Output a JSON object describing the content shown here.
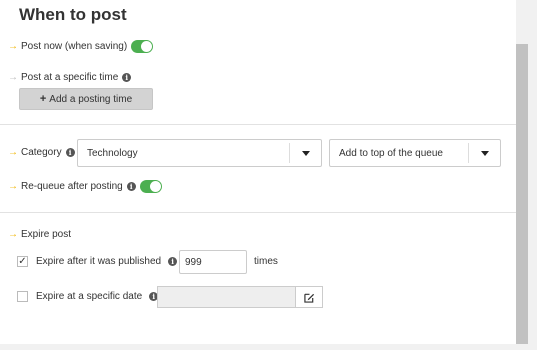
{
  "heading": "When to post",
  "post_now": {
    "label": "Post now (when saving)",
    "enabled": true
  },
  "post_specific": {
    "label": "Post at a specific time",
    "button_label": "Add a posting time"
  },
  "category": {
    "label": "Category",
    "value": "Technology",
    "queue_value": "Add to top of the queue"
  },
  "requeue": {
    "label": "Re-queue after posting",
    "enabled": true
  },
  "expire": {
    "label": "Expire post",
    "after_published_label": "Expire after it was published",
    "after_published_checked": true,
    "times_value": "999",
    "times_unit": "times",
    "specific_date_label": "Expire at a specific date",
    "specific_date_checked": false,
    "date_value": ""
  },
  "icons": {
    "arrow": "arrow-right-icon",
    "info": "info-icon",
    "plus": "plus-icon",
    "caret": "chevron-down-icon",
    "edit": "edit-icon",
    "check": "check-icon"
  },
  "colors": {
    "accent": "#f0b400",
    "toggle_on": "#4caf50",
    "button_bg": "#d3d3d3"
  }
}
